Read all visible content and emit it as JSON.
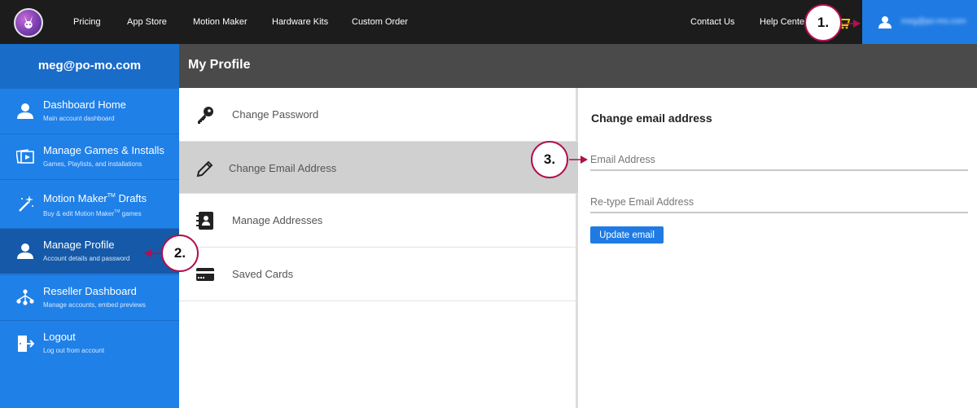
{
  "topbar": {
    "nav": [
      "Pricing",
      "App Store",
      "Motion Maker",
      "Hardware Kits",
      "Custom Order"
    ],
    "right_links": [
      "Contact Us",
      "Help Center"
    ],
    "account_email": "meg@po-mo.com"
  },
  "sidebar": {
    "email": "meg@po-mo.com",
    "items": [
      {
        "title": "Dashboard Home",
        "sub": "Main account dashboard",
        "icon": "user-icon"
      },
      {
        "title": "Manage Games & Installs",
        "sub": "Games, Playlists, and installations",
        "icon": "media-icon"
      },
      {
        "title_main": "Motion Maker",
        "title_tm": "TM",
        "title_end": " Drafts",
        "sub_main": "Buy & edit Motion Maker",
        "sub_tm": "TM",
        "sub_end": " games",
        "icon": "magic-wand-icon"
      },
      {
        "title": "Manage Profile",
        "sub": "Account details and password",
        "icon": "user-icon",
        "active": true
      },
      {
        "title": "Reseller Dashboard",
        "sub": "Manage accounts, embed previews",
        "icon": "network-icon"
      },
      {
        "title": "Logout",
        "sub": "Log out from account",
        "icon": "logout-icon"
      }
    ]
  },
  "header": {
    "title": "My Profile"
  },
  "menu": {
    "items": [
      {
        "label": "Change Password",
        "icon": "key-icon"
      },
      {
        "label": "Change Email Address",
        "icon": "pencil-icon",
        "active": true
      },
      {
        "label": "Manage Addresses",
        "icon": "address-book-icon"
      },
      {
        "label": "Saved Cards",
        "icon": "credit-card-icon"
      }
    ]
  },
  "form": {
    "title": "Change email address",
    "email_placeholder": "Email Address",
    "retype_placeholder": "Re-type Email Address",
    "submit_label": "Update email"
  },
  "annotations": [
    "1.",
    "2.",
    "3."
  ],
  "colors": {
    "accent": "#1f7be3",
    "sidebar": "#1f80e8",
    "callout_border": "#b0104f",
    "topbar": "#1c1c1c"
  }
}
